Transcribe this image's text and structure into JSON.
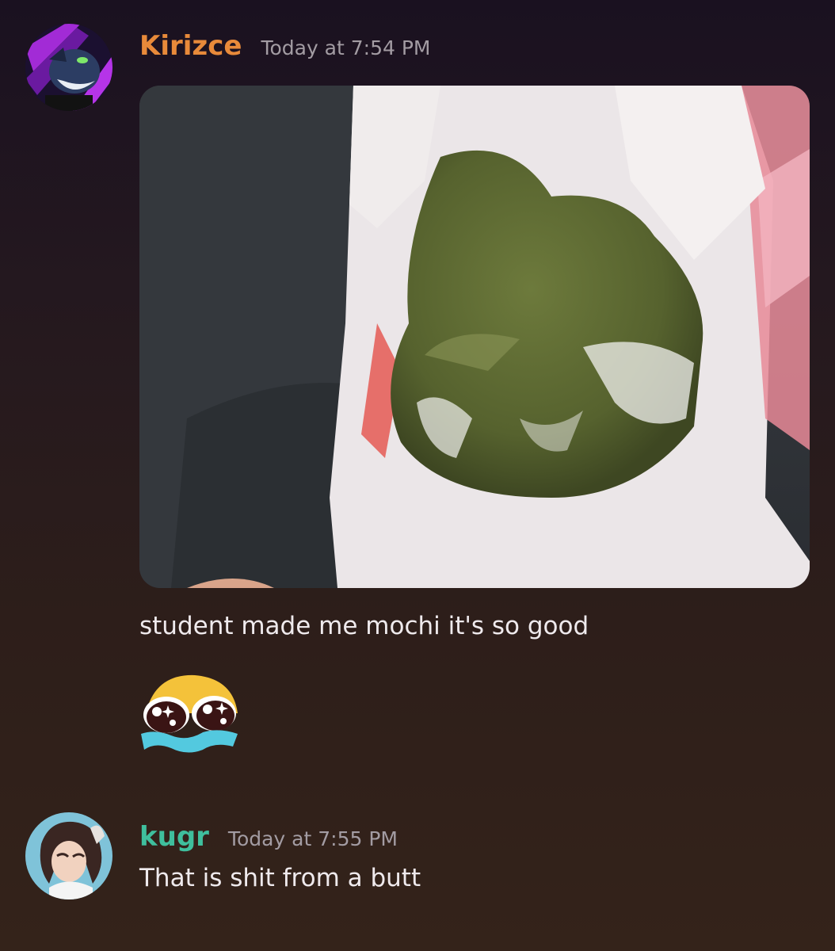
{
  "messages": [
    {
      "username": "Kirizce",
      "username_color": "#e88a3a",
      "timestamp": "Today at 7:54 PM",
      "attachment": {
        "type": "image",
        "subject": "mochi-photo"
      },
      "text": "student made me mochi it's so good",
      "emoji": "crying-sparkle-eyes-emoji"
    },
    {
      "username": "kugr",
      "username_color": "#3fbf9d",
      "timestamp": "Today at 7:55 PM",
      "text": "That is shit from a butt"
    }
  ]
}
